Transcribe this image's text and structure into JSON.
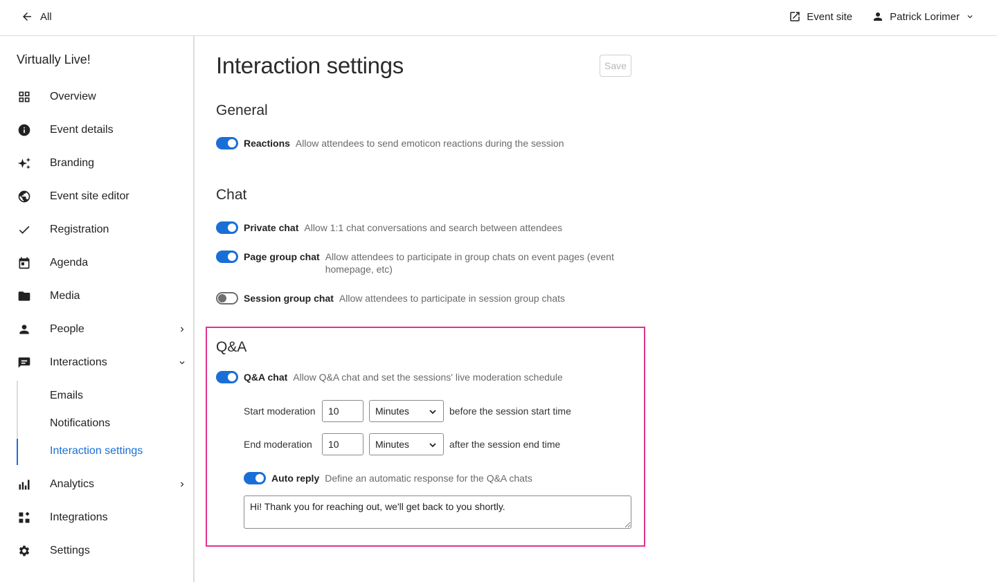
{
  "topbar": {
    "back_label": "All",
    "event_site_label": "Event site",
    "user_name": "Patrick Lorimer"
  },
  "sidebar": {
    "app_name": "Virtually Live!",
    "items": [
      {
        "label": "Overview",
        "icon": "grid-icon"
      },
      {
        "label": "Event details",
        "icon": "info-icon"
      },
      {
        "label": "Branding",
        "icon": "sparkle-icon"
      },
      {
        "label": "Event site editor",
        "icon": "globe-icon"
      },
      {
        "label": "Registration",
        "icon": "check-icon"
      },
      {
        "label": "Agenda",
        "icon": "calendar-icon"
      },
      {
        "label": "Media",
        "icon": "folder-icon"
      },
      {
        "label": "People",
        "icon": "person-icon"
      },
      {
        "label": "Interactions",
        "icon": "chat-icon"
      },
      {
        "label": "Analytics",
        "icon": "bar-chart-icon"
      },
      {
        "label": "Integrations",
        "icon": "integrations-icon"
      },
      {
        "label": "Settings",
        "icon": "gear-icon"
      }
    ],
    "sub_items": [
      "Emails",
      "Notifications",
      "Interaction settings"
    ],
    "active_sub_item": "Interaction settings",
    "accent_color": "#1a6fd6"
  },
  "main": {
    "title": "Interaction settings",
    "save_label": "Save",
    "general": {
      "title": "General",
      "reactions": {
        "label": "Reactions",
        "desc": "Allow attendees to send emoticon reactions during the session",
        "on": true
      }
    },
    "chat": {
      "title": "Chat",
      "private_chat": {
        "label": "Private chat",
        "desc": "Allow 1:1 chat conversations and search between attendees",
        "on": true
      },
      "page_group_chat": {
        "label": "Page group chat",
        "desc": "Allow attendees to participate in group chats on event pages (event homepage, etc)",
        "on": true
      },
      "session_group_chat": {
        "label": "Session group chat",
        "desc": "Allow attendees to participate in session group chats",
        "on": false
      }
    },
    "qa": {
      "title": "Q&A",
      "highlight_color": "#e0318a",
      "qa_chat": {
        "label": "Q&A chat",
        "desc": "Allow Q&A chat and set the sessions' live moderation schedule",
        "on": true
      },
      "start_moderation": {
        "label": "Start moderation",
        "value": "10",
        "unit": "Minutes",
        "after": "before the session start time"
      },
      "end_moderation": {
        "label": "End moderation",
        "value": "10",
        "unit": "Minutes",
        "after": "after the session end time"
      },
      "auto_reply": {
        "label": "Auto reply",
        "desc": "Define an automatic response for the Q&A chats",
        "on": true,
        "message": "Hi! Thank you for reaching out, we'll get back to you shortly."
      }
    }
  }
}
